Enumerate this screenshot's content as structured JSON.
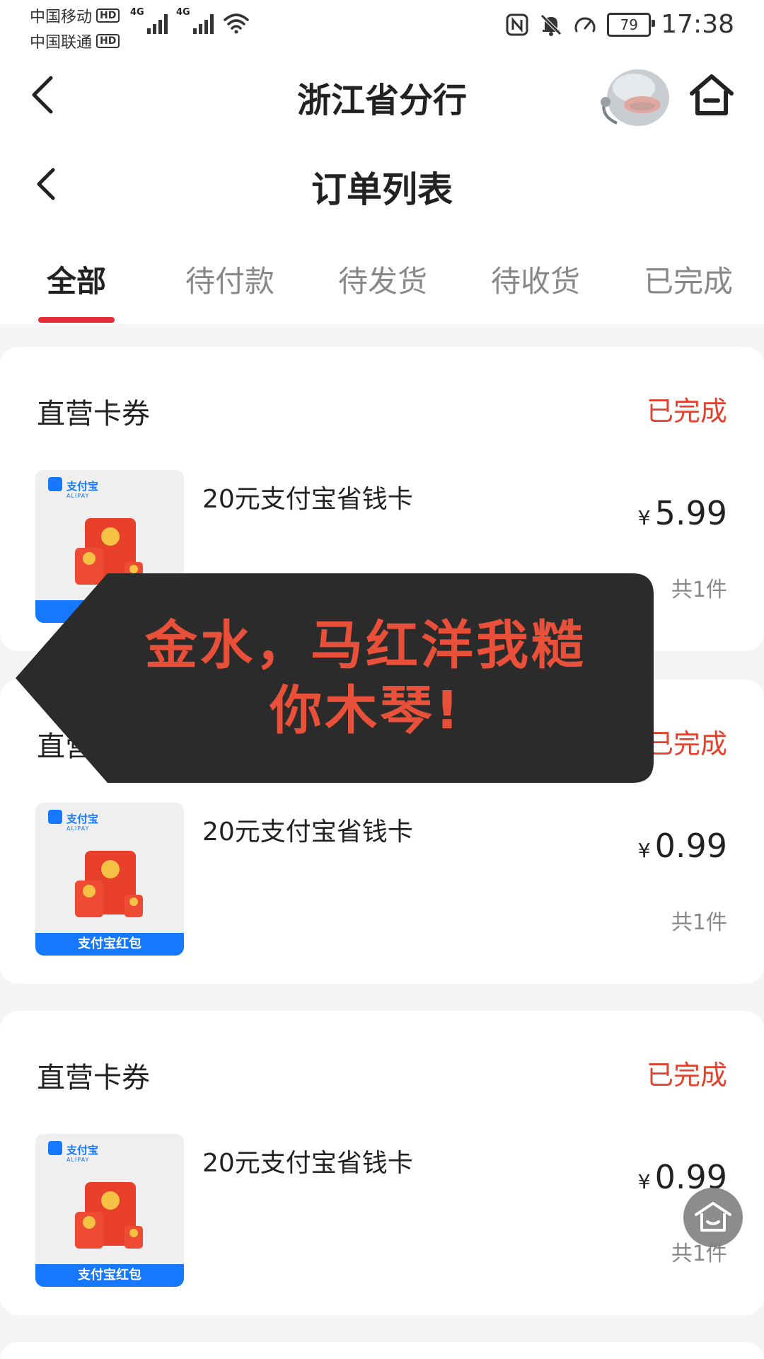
{
  "status_bar": {
    "carrier_1": "中国移动",
    "carrier_2": "中国联通",
    "hd_label": "HD",
    "network_type": "4G",
    "battery": "79",
    "time": "17:38"
  },
  "header": {
    "title": "浙江省分行",
    "back_icon": "chevron-left-icon",
    "home_icon": "home-icon"
  },
  "sub_header": {
    "title": "订单列表",
    "back_icon": "chevron-left-icon"
  },
  "tabs": [
    {
      "label": "全部",
      "active": true
    },
    {
      "label": "待付款",
      "active": false
    },
    {
      "label": "待发货",
      "active": false
    },
    {
      "label": "待收货",
      "active": false
    },
    {
      "label": "已完成",
      "active": false
    }
  ],
  "orders": [
    {
      "store": "直营卡券",
      "status": "已完成",
      "product_name": "20元支付宝省钱卡",
      "currency": "¥",
      "price": "5.99",
      "quantity": "共1件",
      "thumb_brand": "支付宝",
      "thumb_brand_sub": "ALIPAY",
      "thumb_caption": "支付宝红包"
    },
    {
      "store": "直营卡券",
      "status": "已完成",
      "product_name": "20元支付宝省钱卡",
      "currency": "¥",
      "price": "0.99",
      "quantity": "共1件",
      "thumb_brand": "支付宝",
      "thumb_brand_sub": "ALIPAY",
      "thumb_caption": "支付宝红包"
    },
    {
      "store": "直营卡券",
      "status": "已完成",
      "product_name": "20元支付宝省钱卡",
      "currency": "¥",
      "price": "0.99",
      "quantity": "共1件",
      "thumb_brand": "支付宝",
      "thumb_brand_sub": "ALIPAY",
      "thumb_caption": "支付宝红包"
    }
  ],
  "overlay": {
    "line_1": "金水，马红洋我糙",
    "line_2": "你木琴!"
  },
  "floating_button": {
    "icon": "home-icon"
  },
  "colors": {
    "accent_red": "#e32b33",
    "status_red": "#e3432e",
    "alipay_blue": "#1677ff",
    "overlay_bg": "#2b2b2b",
    "overlay_text": "#e9503a"
  }
}
